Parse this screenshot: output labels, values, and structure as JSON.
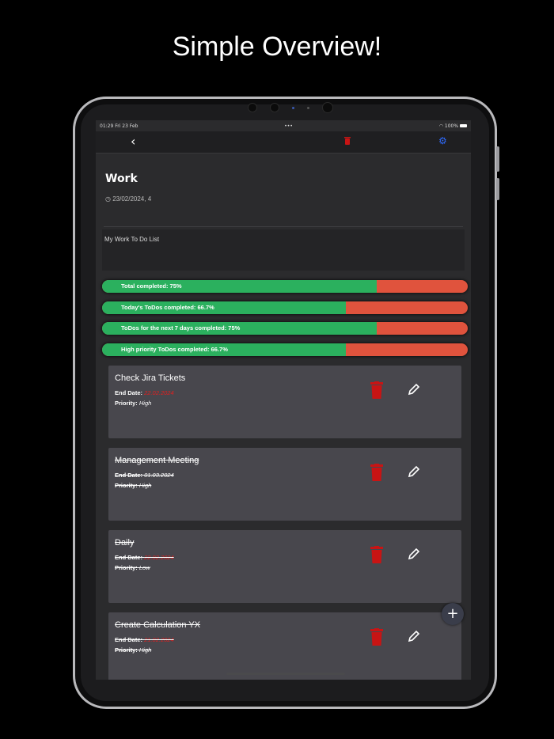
{
  "headline": "Simple Overview!",
  "status": {
    "time_date": "01:29  Fri 23 Feb",
    "dots": "•••",
    "battery": "100%"
  },
  "nav": {
    "back_icon": "chevron-left-icon",
    "delete_icon": "trash-icon",
    "settings_icon": "gear-icon"
  },
  "list": {
    "title": "Work",
    "date": "23/02/2024, 4",
    "description": "My Work To Do List"
  },
  "stats": [
    {
      "label": "Total completed: 75%",
      "percent": 75
    },
    {
      "label": "Today's ToDos completed: 66.7%",
      "percent": 66.7
    },
    {
      "label": "ToDos for the next 7 days completed: 75%",
      "percent": 75
    },
    {
      "label": "High priority ToDos completed: 66.7%",
      "percent": 66.7
    }
  ],
  "labels": {
    "end_date": "End Date:",
    "priority": "Priority:"
  },
  "todos": [
    {
      "title": "Check Jira Tickets",
      "end_date": "22.02.2024",
      "priority": "High",
      "done": false
    },
    {
      "title": "Management Meeting",
      "end_date": "01.03.2024",
      "priority": "High",
      "done": true
    },
    {
      "title": "Daily",
      "end_date": "22.02.2024",
      "priority": "Low",
      "done": true
    },
    {
      "title": "Create Calculation YX",
      "end_date": "21.02.2024",
      "priority": "High",
      "done": true
    }
  ],
  "fab": "+",
  "colors": {
    "complete": "#2bb05e",
    "incomplete": "#e0533d",
    "delete": "#c81414",
    "accent": "#2f6bff"
  }
}
